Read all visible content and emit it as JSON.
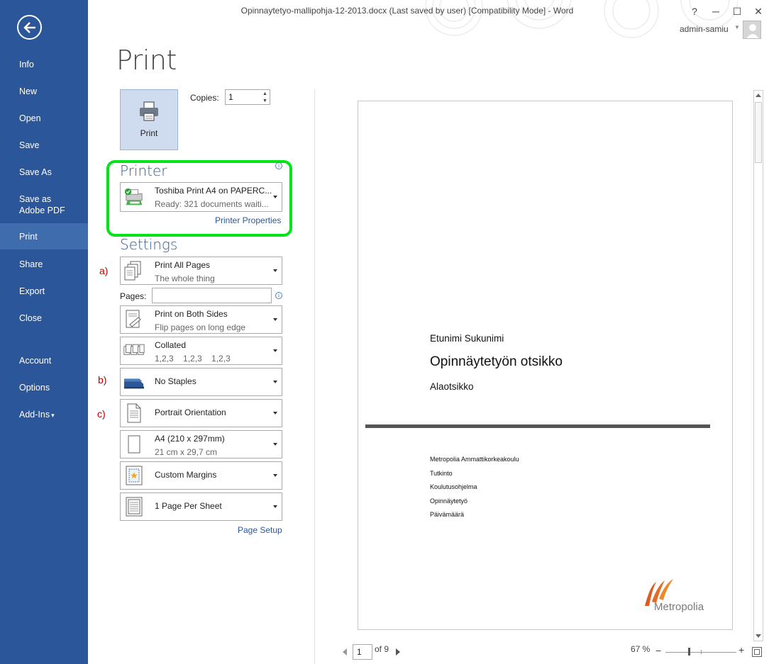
{
  "window": {
    "title": "Opinnaytetyo-mallipohja-12-2013.docx (Last saved by user) [Compatibility Mode] - Word",
    "help": "?",
    "minimize": "─",
    "maximize": "☐",
    "close": "✕",
    "user": "admin-samiu"
  },
  "sidebar": {
    "items": [
      {
        "label": "Info"
      },
      {
        "label": "New"
      },
      {
        "label": "Open"
      },
      {
        "label": "Save"
      },
      {
        "label": "Save As"
      },
      {
        "label": "Save as Adobe PDF"
      },
      {
        "label": "Print"
      },
      {
        "label": "Share"
      },
      {
        "label": "Export"
      },
      {
        "label": "Close"
      },
      {
        "label": "Account"
      },
      {
        "label": "Options"
      },
      {
        "label": "Add-Ins"
      }
    ],
    "active": "Print",
    "addins_caret": "▾"
  },
  "print": {
    "heading": "Print",
    "button_label": "Print",
    "copies_label": "Copies:",
    "copies_value": "1",
    "printer_heading": "Printer",
    "printer_name": "Toshiba Print A4 on PAPERC...",
    "printer_status": "Ready: 321 documents waiti...",
    "printer_properties": "Printer Properties",
    "settings_heading": "Settings",
    "info_glyph": "i",
    "pages_label": "Pages:",
    "pages_value": "",
    "settings": [
      {
        "title": "Print All Pages",
        "subtitle": "The whole thing",
        "icon": "pages-icon"
      },
      {
        "title": "Print on Both Sides",
        "subtitle": "Flip pages on long edge",
        "icon": "duplex-icon"
      },
      {
        "title": "Collated",
        "subtitle": "1,2,3    1,2,3    1,2,3",
        "icon": "collated-icon"
      },
      {
        "title": "No Staples",
        "subtitle": "",
        "icon": "stapler-icon"
      },
      {
        "title": "Portrait Orientation",
        "subtitle": "",
        "icon": "portrait-icon"
      },
      {
        "title": "A4 (210 x 297mm)",
        "subtitle": "21 cm x 29,7 cm",
        "icon": "paper-size-icon"
      },
      {
        "title": "Custom Margins",
        "subtitle": "",
        "icon": "margins-icon"
      },
      {
        "title": "1 Page Per Sheet",
        "subtitle": "",
        "icon": "pages-per-sheet-icon"
      }
    ],
    "page_setup": "Page Setup",
    "annotations": {
      "a": "a)",
      "b": "b)",
      "c": "c)"
    }
  },
  "preview": {
    "author": "Etunimi Sukunimi",
    "title": "Opinnäytetyön otsikko",
    "subtitle": "Alaotsikko",
    "details": [
      "Metropolia Ammattikorkeakoulu",
      "Tutkinto",
      "Koulutusohjelma",
      "Opinnäytetyö",
      "Päivämäärä"
    ],
    "logo_text": "Metropolia",
    "current_page": "1",
    "total_pages": "of 9",
    "zoom": "67 %",
    "zoom_minus": "−",
    "zoom_plus": "+"
  },
  "colors": {
    "sidebar": "#2b579a",
    "sidebar_active": "#3f6cac",
    "accent_text": "#2e5e9e",
    "highlight_border": "#00e51a",
    "annotation": "#c00000",
    "logo_orange": "#e05a1e",
    "logo_text": "#7a7a7a"
  }
}
